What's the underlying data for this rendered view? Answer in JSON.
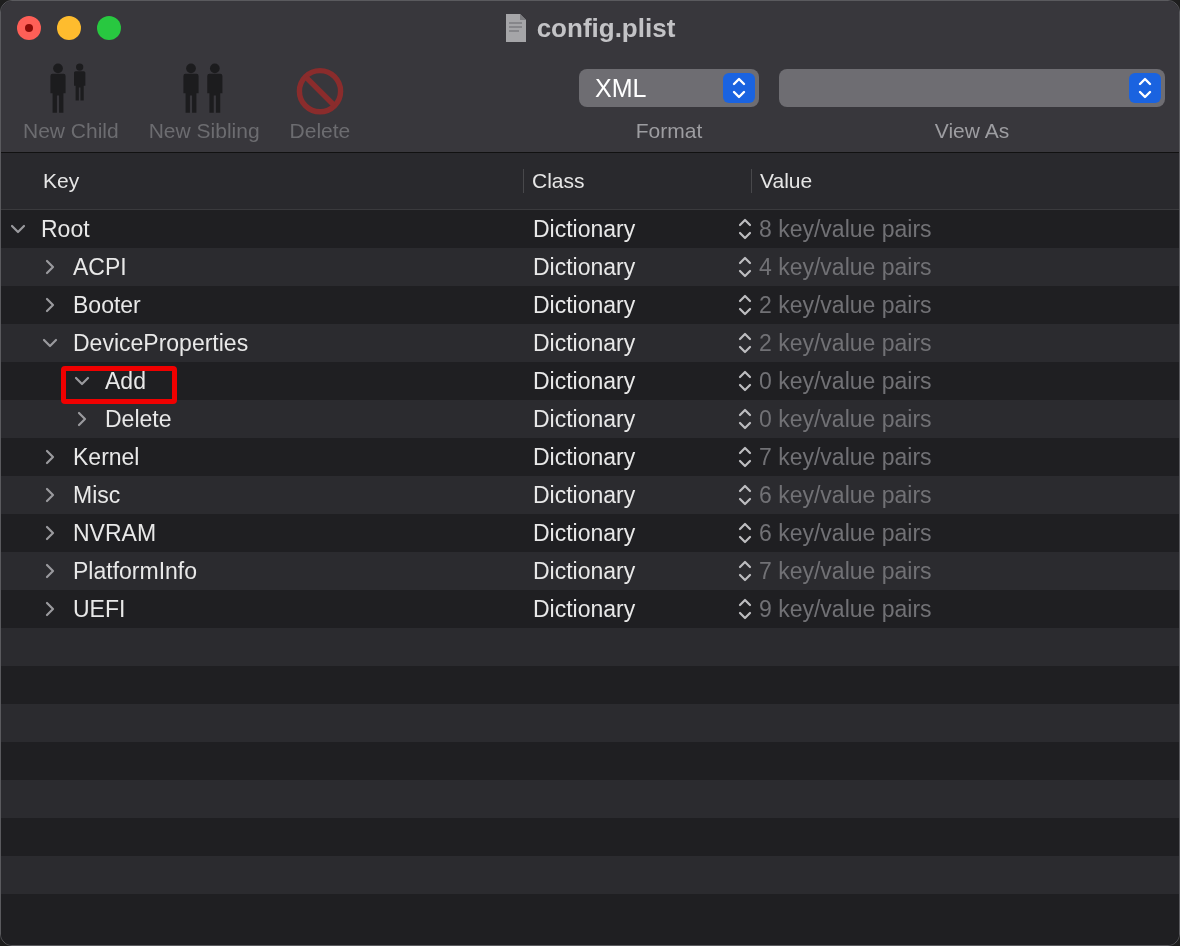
{
  "window": {
    "title": "config.plist"
  },
  "toolbar": {
    "buttons": [
      {
        "kind": "new-child",
        "label": "New Child",
        "disabled": true
      },
      {
        "kind": "new-sibling",
        "label": "New Sibling",
        "disabled": true
      },
      {
        "kind": "delete",
        "label": "Delete",
        "disabled": true
      }
    ],
    "format": {
      "label": "Format",
      "value": "XML"
    },
    "view_as": {
      "label": "View As"
    }
  },
  "table": {
    "columns": [
      "Key",
      "Class",
      "Value"
    ],
    "rows": [
      {
        "key": "Root",
        "class": "Dictionary",
        "value": "8 key/value pairs",
        "expanded": true,
        "highlighted": false,
        "children": [
          {
            "key": "ACPI",
            "class": "Dictionary",
            "value": "4 key/value pairs",
            "expanded": false,
            "highlighted": false
          },
          {
            "key": "Booter",
            "class": "Dictionary",
            "value": "2 key/value pairs",
            "expanded": false,
            "highlighted": false
          },
          {
            "key": "DeviceProperties",
            "class": "Dictionary",
            "value": "2 key/value pairs",
            "expanded": true,
            "highlighted": false,
            "children": [
              {
                "key": "Add",
                "class": "Dictionary",
                "value": "0 key/value pairs",
                "expanded": true,
                "highlighted": true
              },
              {
                "key": "Delete",
                "class": "Dictionary",
                "value": "0 key/value pairs",
                "expanded": false,
                "highlighted": false
              }
            ]
          },
          {
            "key": "Kernel",
            "class": "Dictionary",
            "value": "7 key/value pairs",
            "expanded": false,
            "highlighted": false
          },
          {
            "key": "Misc",
            "class": "Dictionary",
            "value": "6 key/value pairs",
            "expanded": false,
            "highlighted": false
          },
          {
            "key": "NVRAM",
            "class": "Dictionary",
            "value": "6 key/value pairs",
            "expanded": false,
            "highlighted": false
          },
          {
            "key": "PlatformInfo",
            "class": "Dictionary",
            "value": "7 key/value pairs",
            "expanded": false,
            "highlighted": false
          },
          {
            "key": "UEFI",
            "class": "Dictionary",
            "value": "9 key/value pairs",
            "expanded": false,
            "highlighted": false
          }
        ]
      }
    ]
  }
}
